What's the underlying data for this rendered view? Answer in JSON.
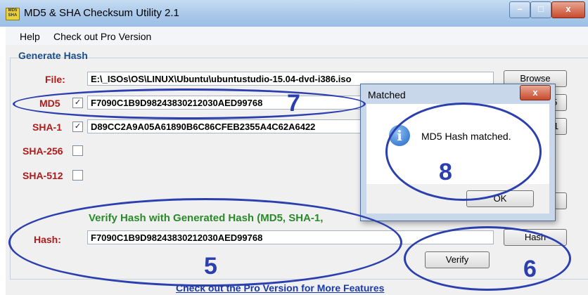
{
  "window": {
    "title": "MD5 & SHA Checksum Utility 2.1",
    "icon_text": "MD5 SHA",
    "controls": {
      "minimize": "–",
      "maximize": "□",
      "close": "x"
    }
  },
  "menu": {
    "items": [
      "Help",
      "Check out Pro Version"
    ]
  },
  "generate": {
    "group_label": "Generate Hash",
    "file_label": "File:",
    "file_path": "E:\\_ISOs\\OS\\LINUX\\Ubuntu\\ubuntustudio-15.04-dvd-i386.iso",
    "browse_label": "Browse",
    "md5_label": "MD5",
    "md5_checked": true,
    "md5_value": "F7090C1B9D98243830212030AED99768",
    "md5_button": "D5",
    "sha1_label": "SHA-1",
    "sha1_checked": true,
    "sha1_value": "D89CC2A9A05A61890B6C86CFEB2355A4C62A6422",
    "sha1_button": "A-1",
    "sha256_label": "SHA-256",
    "sha256_checked": false,
    "sha512_label": "SHA-512",
    "sha512_checked": false,
    "all_button": "ll"
  },
  "verify": {
    "title": "Verify Hash with Generated Hash (MD5, SHA-1,",
    "hash_label": "Hash:",
    "hash_value": "F7090C1B9D98243830212030AED99768",
    "paste_button": "Hash",
    "verify_button": "Verify"
  },
  "footer": {
    "pro_link": "Check out the Pro Version for More Features"
  },
  "dialog": {
    "title": "Matched",
    "close": "x",
    "message": "MD5 Hash matched.",
    "ok_label": "OK",
    "icon": "info-icon"
  },
  "annotations": [
    "7",
    "8",
    "5",
    "6"
  ],
  "colors": {
    "label_red": "#b01a1a",
    "group_blue": "#1c4e8a",
    "verify_green": "#2a8a2a",
    "annotation_blue": "#2b3fae"
  }
}
